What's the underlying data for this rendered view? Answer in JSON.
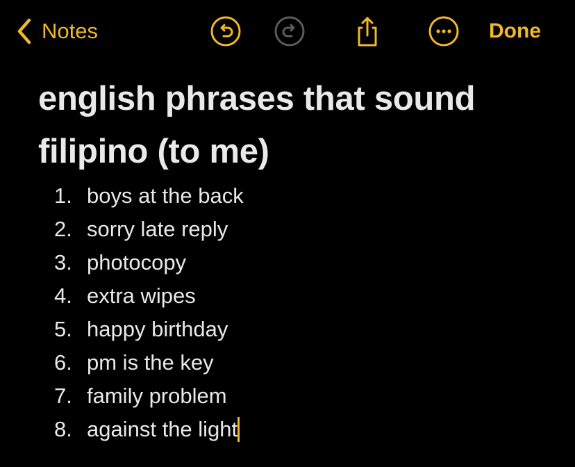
{
  "toolbar": {
    "back_label": "Notes",
    "done_label": "Done"
  },
  "icons": {
    "back": "chevron-left-icon",
    "undo": "undo-icon",
    "redo": "redo-icon",
    "share": "share-icon",
    "more": "more-icon"
  },
  "colors": {
    "accent": "#f1b828",
    "disabled": "#5b5b5e",
    "background": "#000000",
    "text": "#e9e9ea"
  },
  "note": {
    "title": "english phrases that sound filipino (to me)",
    "items": [
      {
        "number": "1.",
        "text": "boys at the back"
      },
      {
        "number": "2.",
        "text": "sorry late reply"
      },
      {
        "number": "3.",
        "text": "photocopy"
      },
      {
        "number": "4.",
        "text": "extra wipes"
      },
      {
        "number": "5.",
        "text": "happy birthday"
      },
      {
        "number": "6.",
        "text": "pm is the key"
      },
      {
        "number": "7.",
        "text": "family problem"
      },
      {
        "number": "8.",
        "text": "against the light"
      }
    ]
  }
}
